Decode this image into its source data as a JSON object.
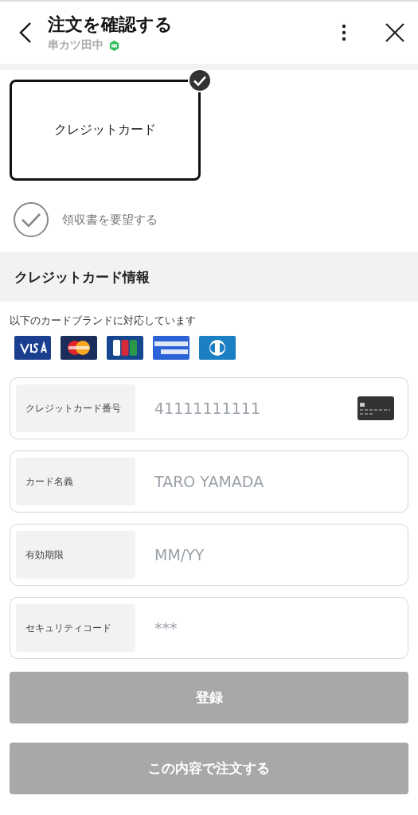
{
  "header": {
    "title": "注文を確認する",
    "shop": "串カツ田中"
  },
  "payment_methods": [
    {
      "label": "クレジットカード",
      "selected": true
    }
  ],
  "receipt": {
    "label": "領収書を要望する",
    "checked": false
  },
  "card_section": {
    "title": "クレジットカード情報",
    "brands_note": "以下のカードブランドに対応しています"
  },
  "fields": [
    {
      "label": "クレジットカード番号",
      "placeholder": "41111111111",
      "kind": "card"
    },
    {
      "label": "カード名義",
      "placeholder": "TARO YAMADA",
      "kind": "text"
    },
    {
      "label": "有効期限",
      "placeholder": "MM/YY",
      "kind": "text"
    },
    {
      "label": "セキュリティコード",
      "placeholder": "***",
      "kind": "text"
    }
  ],
  "buttons": [
    {
      "label": "登録",
      "disabled": true
    },
    {
      "label": "この内容で注文する",
      "disabled": true
    }
  ]
}
